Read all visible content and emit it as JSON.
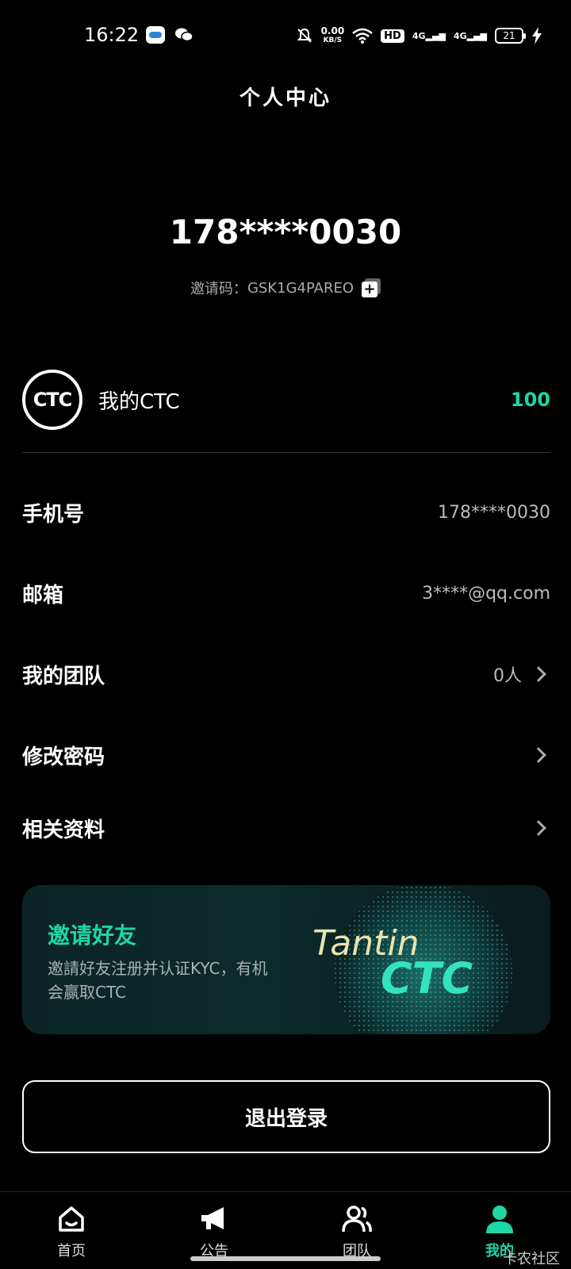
{
  "status_bar": {
    "time": "16:22",
    "net_speed": "0.00",
    "net_unit": "KB/S",
    "hd": "HD",
    "signal_1": "4G",
    "signal_2": "4G",
    "battery": "21"
  },
  "header": {
    "title": "个人中心"
  },
  "profile": {
    "phone": "178****0030",
    "invite_label": "邀请码：",
    "invite_code": "GSK1G4PAREO"
  },
  "ctc": {
    "logo_text": "CTC",
    "label": "我的CTC",
    "value": "100"
  },
  "menu": {
    "phone_label": "手机号",
    "phone_value": "178****0030",
    "email_label": "邮箱",
    "email_value": "3****@qq.com",
    "team_label": "我的团队",
    "team_value": "0人",
    "password_label": "修改密码",
    "docs_label": "相关资料"
  },
  "banner": {
    "title": "邀请好友",
    "desc": "邀請好友注册并认证KYC，有机会赢取CTC",
    "art_word1": "Tantin",
    "art_word2": "CTC"
  },
  "logout_label": "退出登录",
  "tabbar": {
    "home": "首页",
    "notice": "公告",
    "team": "团队",
    "mine": "我的"
  },
  "watermark": "卡农社区",
  "colors": {
    "accent": "#1fd6a6",
    "background": "#000000"
  }
}
